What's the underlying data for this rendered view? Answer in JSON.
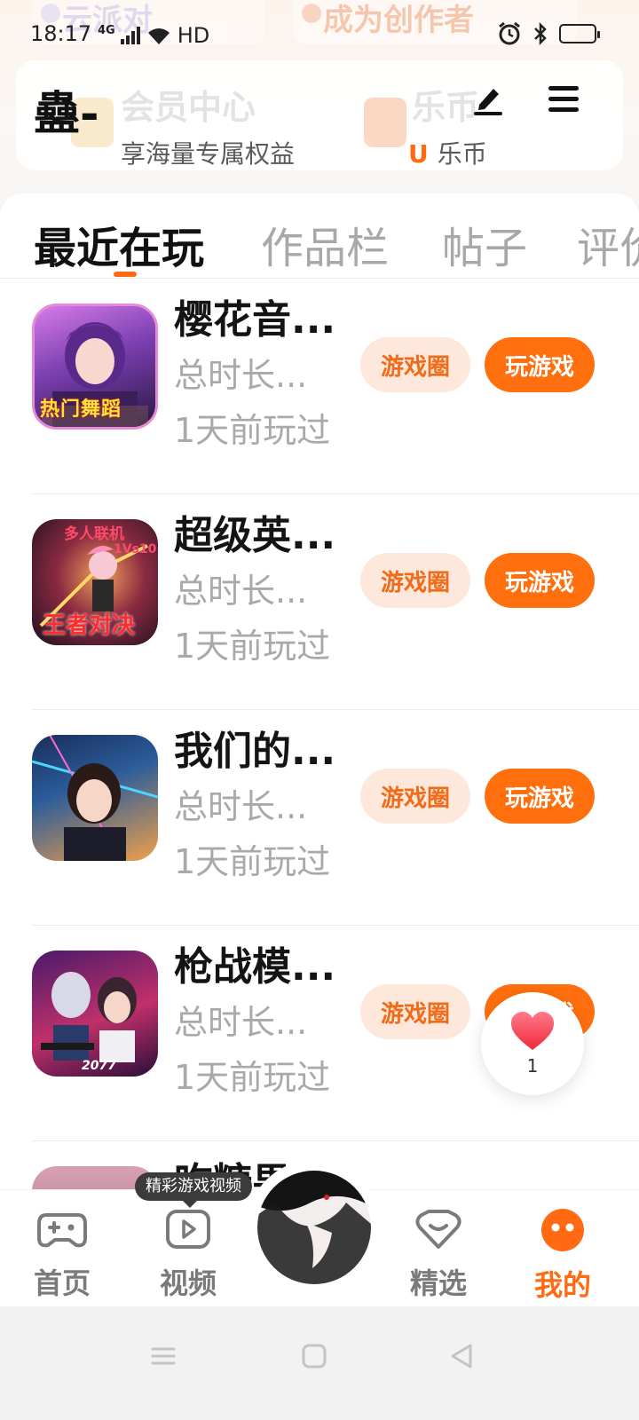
{
  "status_bar": {
    "time": "18:17",
    "network": "4G",
    "wifi_label": "HD",
    "battery_color": "#ffd21e"
  },
  "banner": {
    "ghost_left": "云派对",
    "ghost_right": "成为创作者"
  },
  "profile": {
    "username": "蠱-",
    "edit_icon": "pencil-icon",
    "menu_icon": "hamburger-menu-icon"
  },
  "member_card": {
    "item1_title": "会员中心",
    "item1_sub": "享海量专属权益",
    "item2_title": "乐币",
    "item2_coin": "U",
    "item2_sub": "乐币"
  },
  "tabs": [
    {
      "label": "最近在玩",
      "active": true
    },
    {
      "label": "作品栏",
      "active": false
    },
    {
      "label": "帖子",
      "active": false
    },
    {
      "label": "评价",
      "active": false
    }
  ],
  "games": [
    {
      "name": "樱花音...",
      "duration": "总时长...",
      "last_played": "1天前玩过",
      "circle_label": "游戏圈",
      "play_label": "玩游戏",
      "icon_text": "热门舞蹈"
    },
    {
      "name": "超级英...",
      "duration": "总时长...",
      "last_played": "1天前玩过",
      "circle_label": "游戏圈",
      "play_label": "玩游戏",
      "icon_text_top": "多人联机",
      "icon_text_mid": "1Vs10",
      "icon_text": "王者对决"
    },
    {
      "name": "我们的...",
      "duration": "总时长...",
      "last_played": "1天前玩过",
      "circle_label": "游戏圈",
      "play_label": "玩游戏"
    },
    {
      "name": "枪战模...",
      "duration": "总时长...",
      "last_played": "1天前玩过",
      "circle_label": "游戏圈",
      "play_label": "玩游戏",
      "icon_text": "2077"
    },
    {
      "name": "吃糖果...",
      "duration": "",
      "last_played": "",
      "circle_label": "",
      "play_label": ""
    }
  ],
  "floating": {
    "heart_count": "1"
  },
  "bottom_nav": {
    "tooltip": "精彩游戏视频",
    "items": [
      {
        "label": "首页",
        "icon": "gamepad-icon",
        "active": false
      },
      {
        "label": "视频",
        "icon": "play-video-icon",
        "active": false
      },
      {
        "label": "精选",
        "icon": "heart-chat-icon",
        "active": false
      },
      {
        "label": "我的",
        "icon": "smile-face-icon",
        "active": true
      }
    ],
    "active_color": "#ff6a13"
  }
}
